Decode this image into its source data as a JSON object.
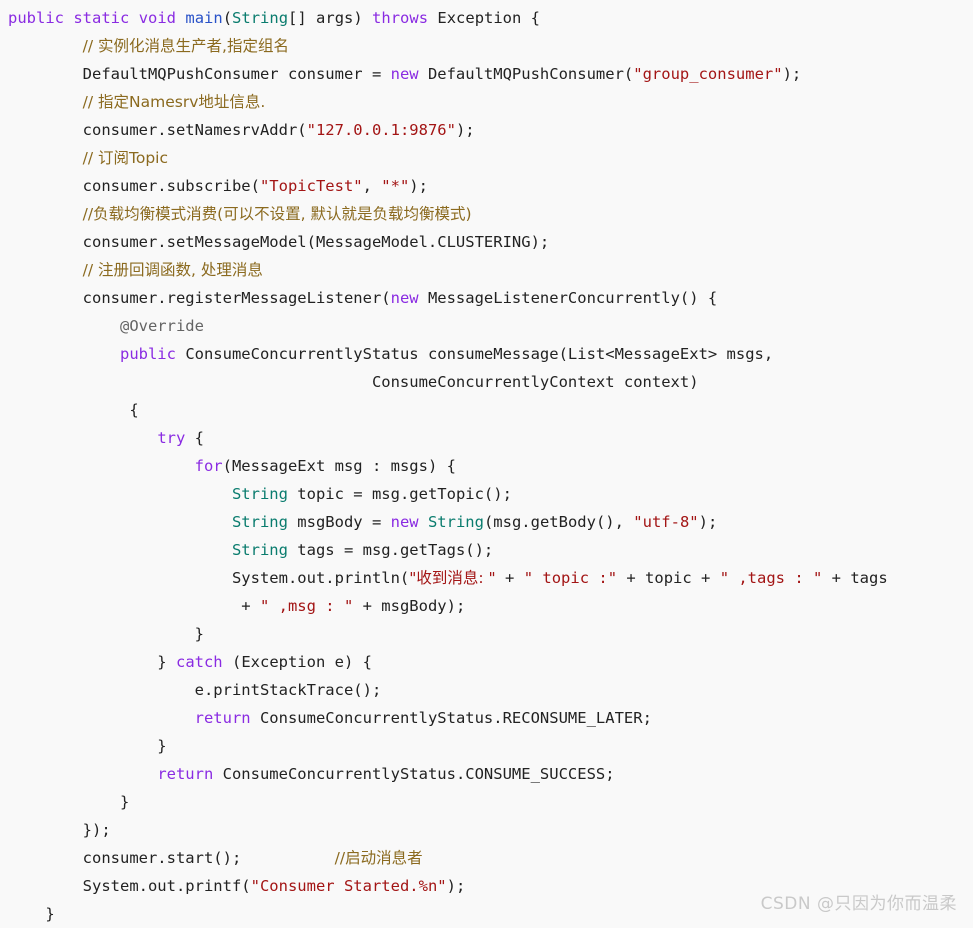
{
  "editor": {
    "language": "Java",
    "background_color": "#f9f9f9",
    "default_text_color": "#222222",
    "font_size_px": 15.5,
    "line_height_px": 28,
    "colors": {
      "keyword": "#8a2be2",
      "type": "#0a7c6e",
      "function": "#2952c8",
      "string": "#a31515",
      "comment": "#8b6a1f",
      "annotation": "#646464",
      "plain": "#222222"
    }
  },
  "code": {
    "lines": [
      [
        {
          "t": "public",
          "c": "kw"
        },
        {
          "t": " ",
          "c": "pln"
        },
        {
          "t": "static",
          "c": "kw"
        },
        {
          "t": " ",
          "c": "pln"
        },
        {
          "t": "void",
          "c": "kw"
        },
        {
          "t": " ",
          "c": "pln"
        },
        {
          "t": "main",
          "c": "fn"
        },
        {
          "t": "(",
          "c": "pln"
        },
        {
          "t": "String",
          "c": "typ"
        },
        {
          "t": "[] args) ",
          "c": "pln"
        },
        {
          "t": "throws",
          "c": "kw"
        },
        {
          "t": " Exception {",
          "c": "pln"
        }
      ],
      [
        {
          "t": "        ",
          "c": "pln"
        },
        {
          "t": "// 实例化消息生产者,指定组名",
          "c": "cmt"
        }
      ],
      [
        {
          "t": "        DefaultMQPushConsumer consumer = ",
          "c": "pln"
        },
        {
          "t": "new",
          "c": "kw"
        },
        {
          "t": " DefaultMQPushConsumer(",
          "c": "pln"
        },
        {
          "t": "\"group_consumer\"",
          "c": "str"
        },
        {
          "t": ");",
          "c": "pln"
        }
      ],
      [
        {
          "t": "        ",
          "c": "pln"
        },
        {
          "t": "// 指定Namesrv地址信息.",
          "c": "cmt"
        }
      ],
      [
        {
          "t": "        consumer.setNamesrvAddr(",
          "c": "pln"
        },
        {
          "t": "\"127.0.0.1:9876\"",
          "c": "str"
        },
        {
          "t": ");",
          "c": "pln"
        }
      ],
      [
        {
          "t": "        ",
          "c": "pln"
        },
        {
          "t": "// 订阅Topic",
          "c": "cmt"
        }
      ],
      [
        {
          "t": "        consumer.subscribe(",
          "c": "pln"
        },
        {
          "t": "\"TopicTest\"",
          "c": "str"
        },
        {
          "t": ", ",
          "c": "pln"
        },
        {
          "t": "\"*\"",
          "c": "str"
        },
        {
          "t": ");",
          "c": "pln"
        }
      ],
      [
        {
          "t": "        ",
          "c": "pln"
        },
        {
          "t": "//负载均衡模式消费(可以不设置, 默认就是负载均衡模式)",
          "c": "cmt"
        }
      ],
      [
        {
          "t": "        consumer.setMessageModel(MessageModel.CLUSTERING);",
          "c": "pln"
        }
      ],
      [
        {
          "t": "        ",
          "c": "pln"
        },
        {
          "t": "// 注册回调函数, 处理消息",
          "c": "cmt"
        }
      ],
      [
        {
          "t": "        consumer.registerMessageListener(",
          "c": "pln"
        },
        {
          "t": "new",
          "c": "kw"
        },
        {
          "t": " MessageListenerConcurrently() {",
          "c": "pln"
        }
      ],
      [
        {
          "t": "            ",
          "c": "pln"
        },
        {
          "t": "@Override",
          "c": "ann"
        }
      ],
      [
        {
          "t": "            ",
          "c": "pln"
        },
        {
          "t": "public",
          "c": "kw"
        },
        {
          "t": " ConsumeConcurrentlyStatus consumeMessage(List<MessageExt> msgs,",
          "c": "pln"
        }
      ],
      [
        {
          "t": "                                       ConsumeConcurrentlyContext context)",
          "c": "pln"
        }
      ],
      [
        {
          "t": "             {",
          "c": "pln"
        }
      ],
      [
        {
          "t": "                ",
          "c": "pln"
        },
        {
          "t": "try",
          "c": "kw"
        },
        {
          "t": " {",
          "c": "pln"
        }
      ],
      [
        {
          "t": "                    ",
          "c": "pln"
        },
        {
          "t": "for",
          "c": "kw"
        },
        {
          "t": "(MessageExt msg : msgs) {",
          "c": "pln"
        }
      ],
      [
        {
          "t": "                        ",
          "c": "pln"
        },
        {
          "t": "String",
          "c": "typ"
        },
        {
          "t": " topic = msg.getTopic();",
          "c": "pln"
        }
      ],
      [
        {
          "t": "                        ",
          "c": "pln"
        },
        {
          "t": "String",
          "c": "typ"
        },
        {
          "t": " msgBody = ",
          "c": "pln"
        },
        {
          "t": "new",
          "c": "kw"
        },
        {
          "t": " ",
          "c": "pln"
        },
        {
          "t": "String",
          "c": "typ"
        },
        {
          "t": "(msg.getBody(), ",
          "c": "pln"
        },
        {
          "t": "\"utf-8\"",
          "c": "str"
        },
        {
          "t": ");",
          "c": "pln"
        }
      ],
      [
        {
          "t": "                        ",
          "c": "pln"
        },
        {
          "t": "String",
          "c": "typ"
        },
        {
          "t": " tags = msg.getTags();",
          "c": "pln"
        }
      ],
      [
        {
          "t": "                        System.out.println(",
          "c": "pln"
        },
        {
          "t": "\"收到消息: \"",
          "c": "str"
        },
        {
          "t": " + ",
          "c": "pln"
        },
        {
          "t": "\" topic :\"",
          "c": "str"
        },
        {
          "t": " + topic + ",
          "c": "pln"
        },
        {
          "t": "\" ,tags : \"",
          "c": "str"
        },
        {
          "t": " + tags",
          "c": "pln"
        }
      ],
      [
        {
          "t": "                         + ",
          "c": "pln"
        },
        {
          "t": "\" ,msg : \"",
          "c": "str"
        },
        {
          "t": " + msgBody);",
          "c": "pln"
        }
      ],
      [
        {
          "t": "                    }",
          "c": "pln"
        }
      ],
      [
        {
          "t": "                } ",
          "c": "pln"
        },
        {
          "t": "catch",
          "c": "kw"
        },
        {
          "t": " (Exception e) {",
          "c": "pln"
        }
      ],
      [
        {
          "t": "                    e.printStackTrace();",
          "c": "pln"
        }
      ],
      [
        {
          "t": "                    ",
          "c": "pln"
        },
        {
          "t": "return",
          "c": "kw"
        },
        {
          "t": " ConsumeConcurrentlyStatus.RECONSUME_LATER;",
          "c": "pln"
        }
      ],
      [
        {
          "t": "                }",
          "c": "pln"
        }
      ],
      [
        {
          "t": "                ",
          "c": "pln"
        },
        {
          "t": "return",
          "c": "kw"
        },
        {
          "t": " ConsumeConcurrentlyStatus.CONSUME_SUCCESS;",
          "c": "pln"
        }
      ],
      [
        {
          "t": "            }",
          "c": "pln"
        }
      ],
      [
        {
          "t": "        });",
          "c": "pln"
        }
      ],
      [
        {
          "t": "        consumer.start();          ",
          "c": "pln"
        },
        {
          "t": "//启动消息者",
          "c": "cmt"
        }
      ],
      [
        {
          "t": "        System.out.printf(",
          "c": "pln"
        },
        {
          "t": "\"Consumer Started.%n\"",
          "c": "str"
        },
        {
          "t": ");",
          "c": "pln"
        }
      ],
      [
        {
          "t": "    }",
          "c": "pln"
        }
      ]
    ]
  },
  "watermark": {
    "text": "CSDN @只因为你而温柔",
    "color": "#c9c9c9"
  }
}
